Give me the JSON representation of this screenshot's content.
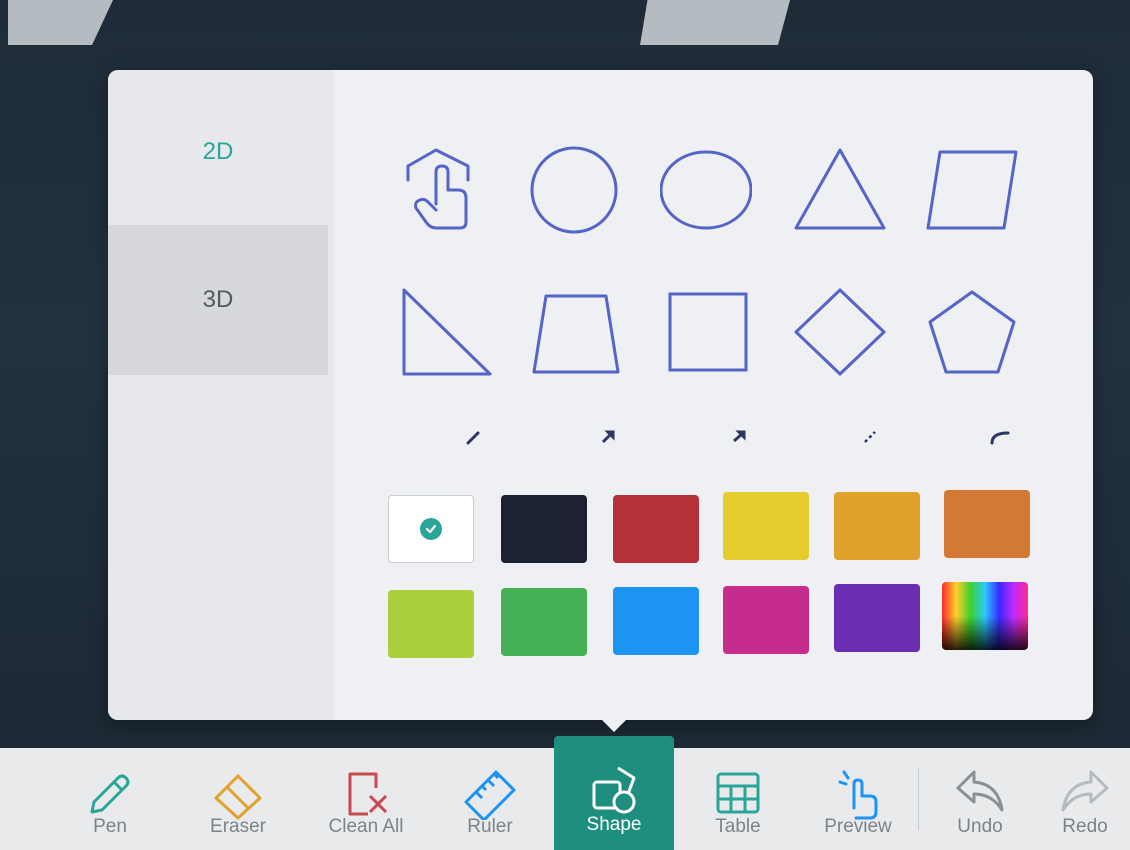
{
  "colors": {
    "accent": "#2aa59a",
    "shape_stroke": "#5564c7",
    "toolbar_active": "#1e8f7f"
  },
  "shape_panel": {
    "tabs": [
      {
        "label": "2D",
        "active": true
      },
      {
        "label": "3D",
        "active": false
      }
    ],
    "shapes_row1": [
      "polygon-hand-icon",
      "circle-icon",
      "ellipse-icon",
      "triangle-icon",
      "parallelogram-icon"
    ],
    "shapes_row2": [
      "right-triangle-icon",
      "trapezoid-icon",
      "square-icon",
      "diamond-icon",
      "pentagon-icon"
    ],
    "lines_row": [
      "line-icon",
      "arrow-icon",
      "double-arrow-icon",
      "dashed-line-icon",
      "arc-icon"
    ],
    "swatches": [
      {
        "name": "white",
        "hex": "#ffffff",
        "selected": true
      },
      {
        "name": "black",
        "hex": "#1c2231"
      },
      {
        "name": "red",
        "hex": "#b7313a"
      },
      {
        "name": "yellow",
        "hex": "#e3cc2c"
      },
      {
        "name": "orange",
        "hex": "#e0a22c"
      },
      {
        "name": "brown-orange",
        "hex": "#d27a33"
      },
      {
        "name": "lime",
        "hex": "#a9cf3a"
      },
      {
        "name": "green",
        "hex": "#45b255"
      },
      {
        "name": "blue",
        "hex": "#1e94f2"
      },
      {
        "name": "magenta",
        "hex": "#c52c8c"
      },
      {
        "name": "purple",
        "hex": "#6b2eb3"
      },
      {
        "name": "custom-spectrum",
        "hex": "spectrum"
      }
    ]
  },
  "toolbar": {
    "items": [
      {
        "label": "Pen",
        "icon": "pen-icon"
      },
      {
        "label": "Eraser",
        "icon": "eraser-icon"
      },
      {
        "label": "Clean All",
        "icon": "clean-all-icon"
      },
      {
        "label": "Ruler",
        "icon": "ruler-icon"
      },
      {
        "label": "Shape",
        "icon": "shape-icon",
        "active": true
      },
      {
        "label": "Table",
        "icon": "table-icon"
      },
      {
        "label": "Preview",
        "icon": "preview-icon"
      },
      {
        "label": "Undo",
        "icon": "undo-icon"
      },
      {
        "label": "Redo",
        "icon": "redo-icon"
      }
    ]
  }
}
